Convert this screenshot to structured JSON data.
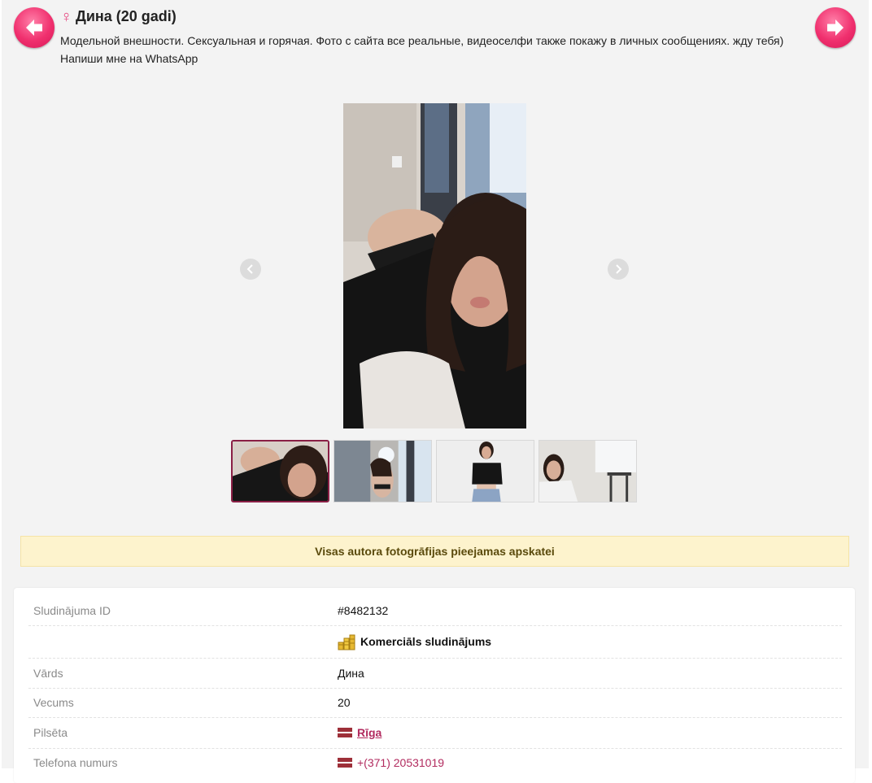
{
  "header": {
    "prev_icon": "arrow-left-icon",
    "next_icon": "arrow-right-icon",
    "gender_symbol": "♀",
    "title": "Дина (20 gadi)",
    "description": "Модельной внешности. Сексуальная и горячая. Фото с сайта все реальные, видеоселфи также покажу в личных сообщениях. жду тебя) Напиши мне на WhatsApp"
  },
  "gallery": {
    "prev_icon": "chevron-left-icon",
    "next_icon": "chevron-right-icon",
    "thumbnail_count": 4,
    "active_thumbnail": 1
  },
  "notice": {
    "text": "Visas autora fotogrāfijas pieejamas apskatei"
  },
  "details": {
    "id_label": "Sludinājuma ID",
    "id_value": "#8482132",
    "commercial_label": "Komerciāls sludinājums",
    "name_label": "Vārds",
    "name_value": "Дина",
    "age_label": "Vecums",
    "age_value": "20",
    "city_label": "Pilsēta",
    "city_value": "Rīga",
    "phone_label": "Telefona numurs",
    "phone_value": "+(371) 20531019"
  },
  "colors": {
    "accent_pink": "#f0306e",
    "link": "#b22b5f",
    "notice_bg": "#fdf3cd",
    "page_bg": "#f3f3f3"
  }
}
